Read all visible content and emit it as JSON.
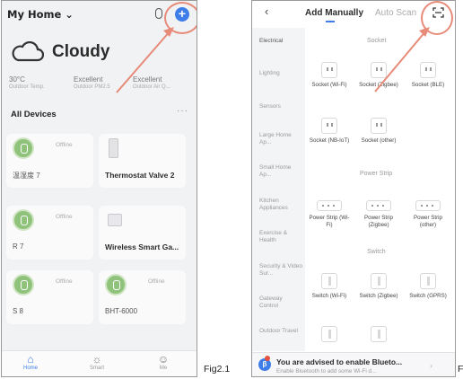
{
  "left_screen": {
    "home_title": "My Home ⌄",
    "weather": {
      "condition": "Cloudy"
    },
    "stats": [
      {
        "value": "30°C",
        "label": "Outdoor Temp."
      },
      {
        "value": "Excellent",
        "label": "Outdoor PM2.5"
      },
      {
        "value": "Excellent",
        "label": "Outdoor Air Q..."
      }
    ],
    "section_title": "All Devices",
    "more_icon": "more-icon",
    "devices": [
      {
        "name": "温湿度 7",
        "status": "Offline",
        "icon": "sensor-icon"
      },
      {
        "name": "Thermostat Valve 2",
        "status": "",
        "icon": "thermostat-icon"
      },
      {
        "name": "R 7",
        "status": "Offline",
        "icon": "sensor-icon"
      },
      {
        "name": "Wireless Smart Ga...",
        "status": "",
        "icon": "gateway-icon"
      },
      {
        "name": "S 8",
        "status": "Offline",
        "icon": "sensor-icon"
      },
      {
        "name": "BHT-6000",
        "status": "Offline",
        "icon": "sensor-icon"
      }
    ],
    "tabs": [
      {
        "label": "Home",
        "icon": "home-icon"
      },
      {
        "label": "Smart",
        "icon": "sun-icon"
      },
      {
        "label": "Me",
        "icon": "person-icon"
      }
    ],
    "accent": "#3f7ee8"
  },
  "caption_left": "Fig2.1",
  "right_screen": {
    "back": "‹",
    "tab_active": "Add Manually",
    "tab_inactive": "Auto Scan",
    "categories": [
      "Electrical",
      "Lighting",
      "Sensors",
      "Large Home Ap...",
      "Small Home Ap...",
      "Kitchen Appliances",
      "Exercise & Health",
      "Security & Video Sur...",
      "Gateway Control",
      "Outdoor Travel"
    ],
    "sections": [
      "Socket",
      "Power Strip",
      "Switch"
    ],
    "socket_items": [
      "Socket (Wi-Fi)",
      "Socket (Zigbee)",
      "Socket (BLE)",
      "Socket (NB-IoT)",
      "Socket (other)"
    ],
    "strip_items": [
      "Power Strip (Wi-Fi)",
      "Power Strip (Zigbee)",
      "Power Strip (other)"
    ],
    "switch_items": [
      "Switch (Wi-Fi)",
      "Switch (Zigbee)",
      "Switch (GPRS)"
    ],
    "bluetooth_title": "You are advised to enable Blueto...",
    "bluetooth_sub": "Enable Bluetooth to add some Wi-Fi d...",
    "highlight_color": "#e78a78"
  },
  "caption_right": "F"
}
